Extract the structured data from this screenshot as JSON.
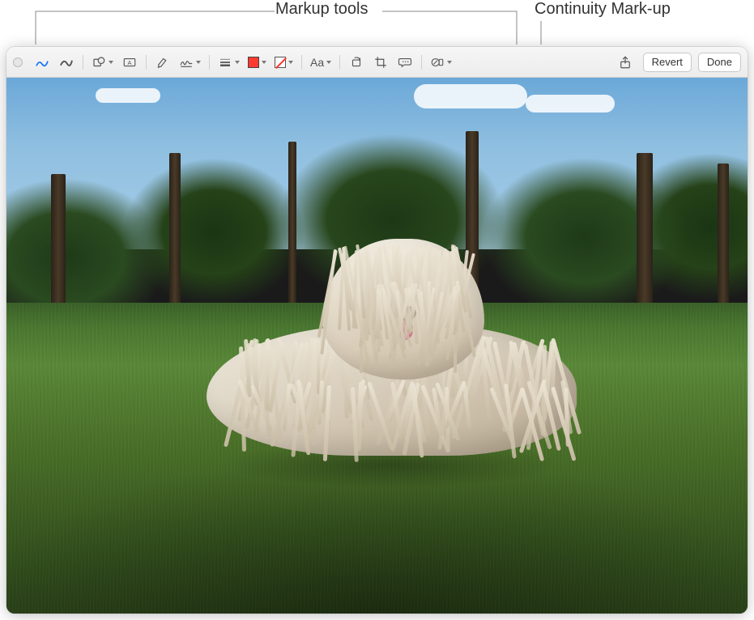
{
  "callouts": {
    "markup_tools": "Markup tools",
    "continuity_markup": "Continuity Mark-up"
  },
  "toolbar": {
    "sketch": "Sketch",
    "draw": "Draw",
    "shapes": "Shapes",
    "text": "Text",
    "highlight": "Highlight",
    "sign": "Sign",
    "shape_style": "Shape Style",
    "border_color": "Border Colour",
    "fill_color": "Fill Colour",
    "text_style": "Text Style",
    "text_style_label": "Aa",
    "rotate": "Rotate",
    "crop": "Crop",
    "image_description": "Image Description",
    "annotate": "Annotate",
    "share": "Share",
    "revert": "Revert",
    "done": "Done"
  },
  "colors": {
    "accent": "#0a6cff",
    "border_color_value": "#ff3b30"
  }
}
